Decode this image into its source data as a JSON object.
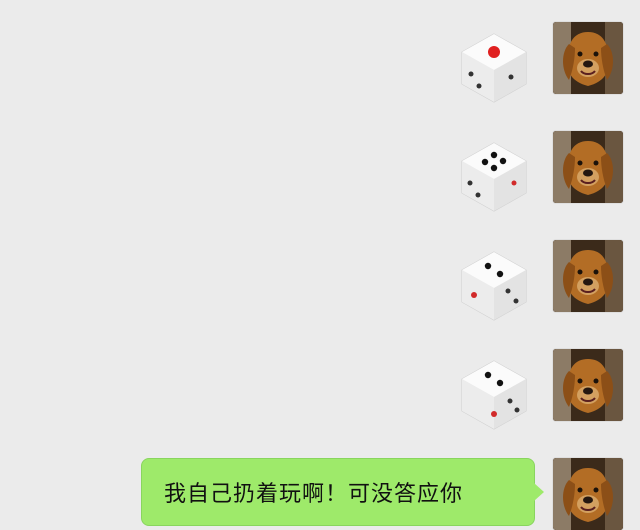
{
  "chat": {
    "messages": [
      {
        "type": "dice",
        "face": 1,
        "sender_avatar": "golden-retriever-avatar"
      },
      {
        "type": "dice",
        "face": 4,
        "sender_avatar": "golden-retriever-avatar"
      },
      {
        "type": "dice",
        "face": 2,
        "sender_avatar": "golden-retriever-avatar"
      },
      {
        "type": "dice",
        "face": 2,
        "sender_avatar": "golden-retriever-avatar"
      },
      {
        "type": "text",
        "text": "我自己扔着玩啊！可没答应你",
        "sender_avatar": "golden-retriever-avatar"
      }
    ]
  },
  "colors": {
    "background": "#ebebeb",
    "bubble": "#9eea6a",
    "dice_one_pip": "#e02020",
    "dice_pip": "#111111"
  }
}
